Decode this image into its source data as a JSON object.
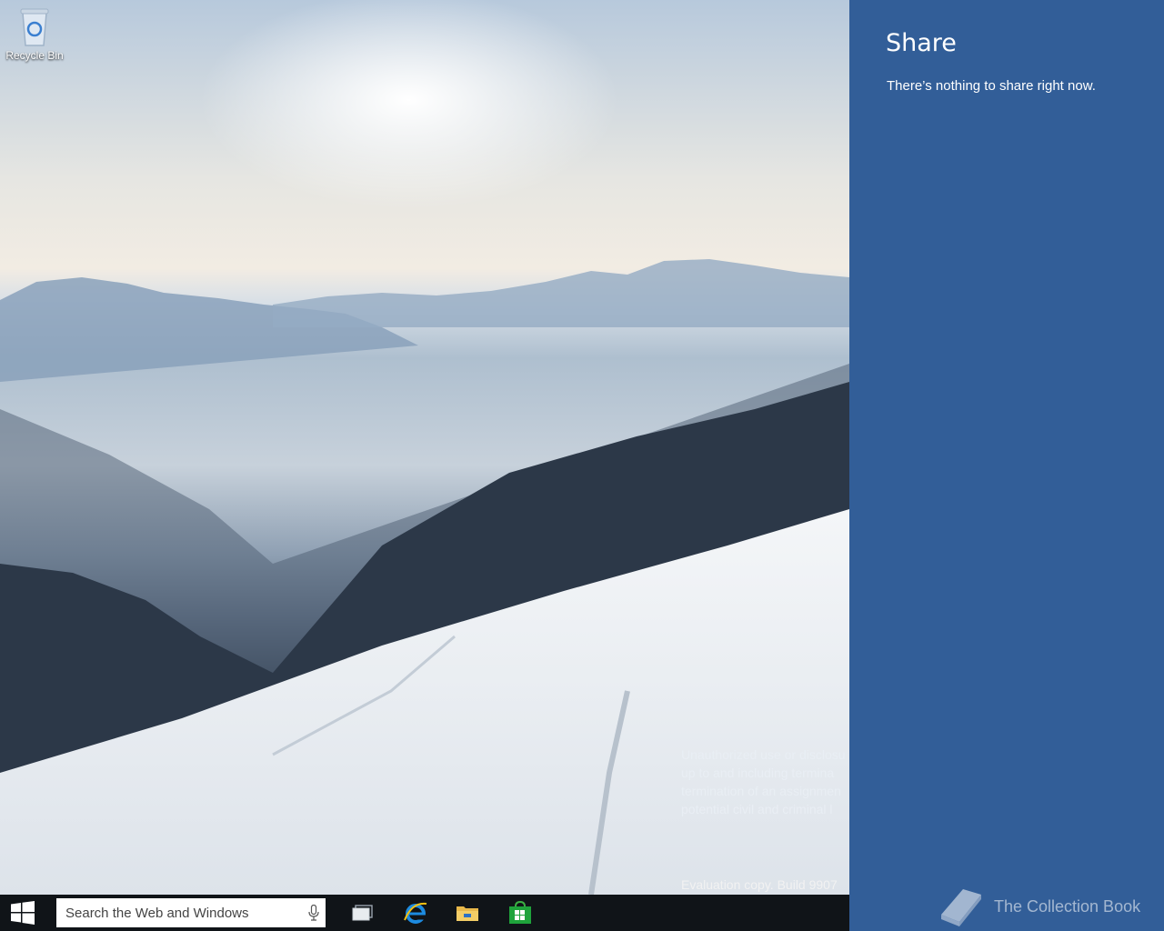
{
  "desktop": {
    "recycle_bin_label": "Recycle Bin",
    "watermark_lines": [
      "Unauthorized use or disclosu",
      "up to and including termina",
      "termination of an assignmen",
      "potential civil and criminal l"
    ],
    "watermark_head": "M",
    "eval_text": "Evaluation copy. Build 9907"
  },
  "taskbar": {
    "search_placeholder": "Search the Web and Windows",
    "icons": [
      "windows-start-icon",
      "microphone-icon",
      "task-view-icon",
      "internet-explorer-icon",
      "file-explorer-icon",
      "store-icon"
    ]
  },
  "share": {
    "title": "Share",
    "message": "There’s nothing to share right now.",
    "accent": "#325e98"
  },
  "brand": {
    "name": "The Collection Book"
  }
}
